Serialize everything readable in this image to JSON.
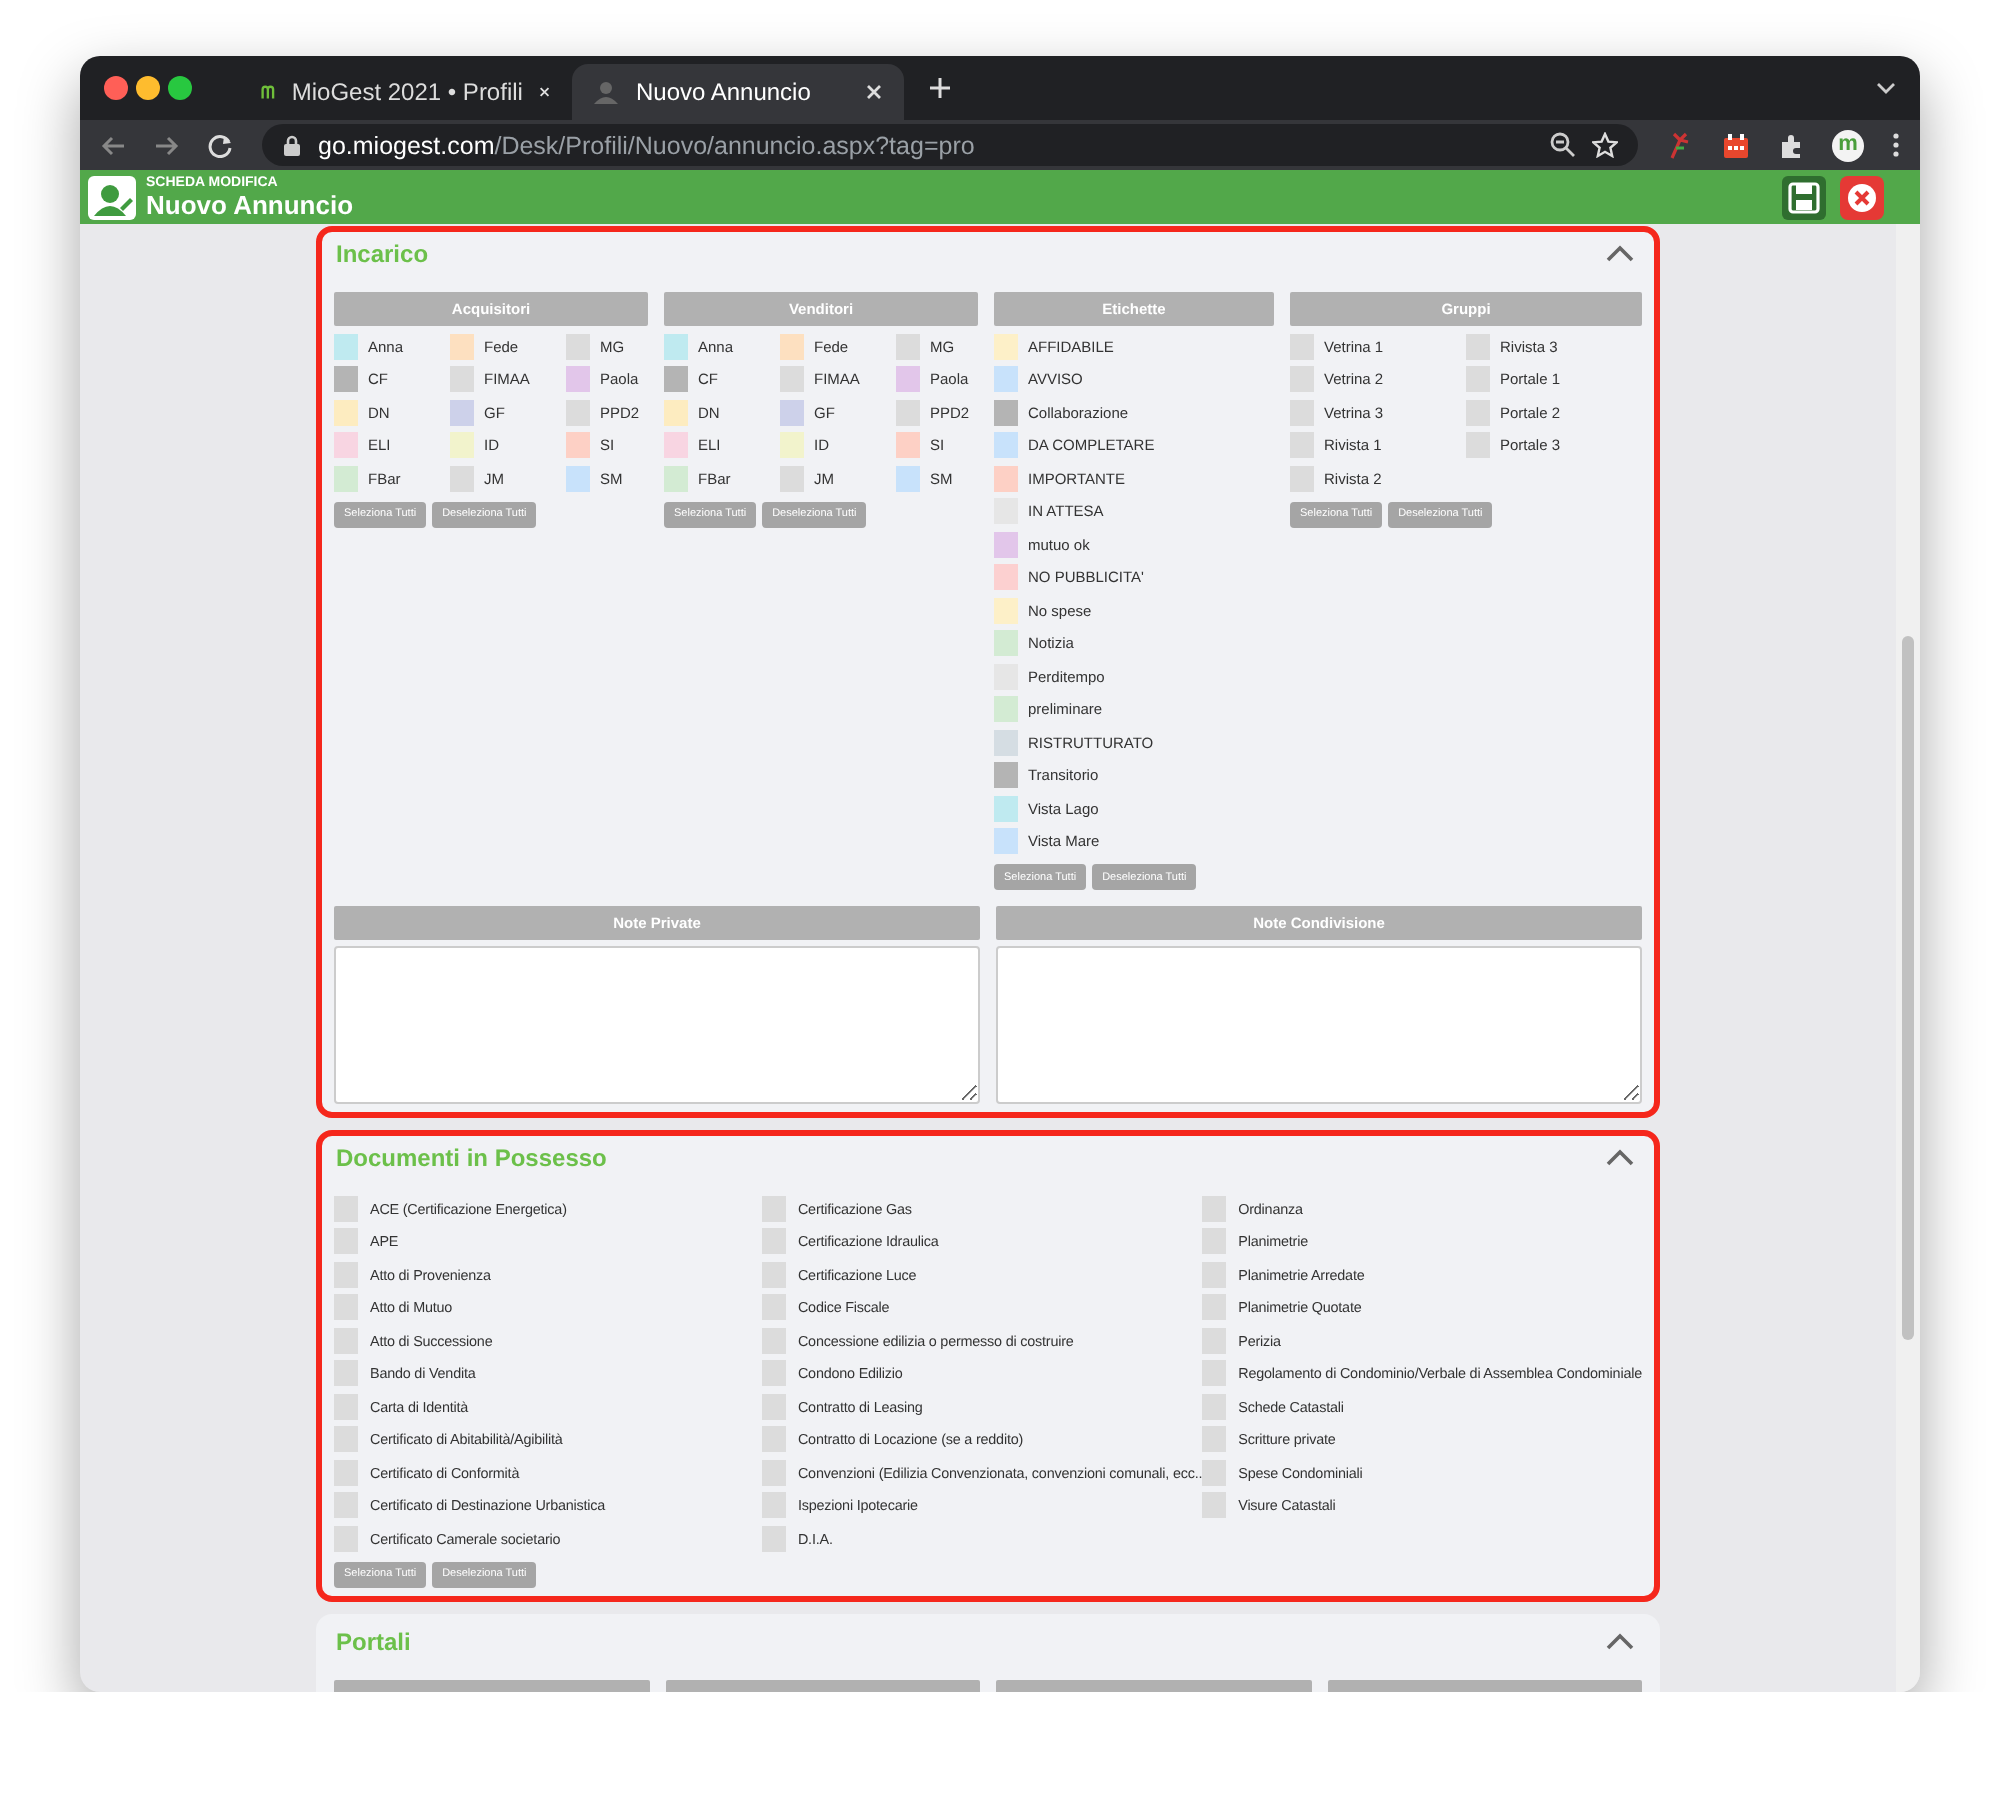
{
  "browser": {
    "tabs": [
      {
        "title": "MioGest 2021 • Profili",
        "selected": false
      },
      {
        "title": "Nuovo Annuncio",
        "selected": true
      }
    ],
    "url_host": "go.miogest.com",
    "url_path": "/Desk/Profili/Nuovo/annuncio.aspx?tag=pro",
    "profile_initial": "m"
  },
  "header": {
    "subtitle": "SCHEDA MODIFICA",
    "title": "Nuovo Annuncio"
  },
  "sections": [
    {
      "title": "Incarico",
      "kind": "groups",
      "highlighted": true,
      "expanded": true,
      "groups": [
        {
          "title": "Acquisitori",
          "columns": [
            [
              {
                "label": "Anna",
                "color": "#bfeaf0"
              },
              {
                "label": "CF",
                "color": "#b4b4b4"
              },
              {
                "label": "DN",
                "color": "#fdecc0"
              },
              {
                "label": "ELI",
                "color": "#f8d5e2"
              },
              {
                "label": "FBar",
                "color": "#d3ebd3"
              }
            ],
            [
              {
                "label": "Fede",
                "color": "#fde0c0"
              },
              {
                "label": "FIMAA",
                "color": "#dcdcdc"
              },
              {
                "label": "GF",
                "color": "#cdd1ea"
              },
              {
                "label": "ID",
                "color": "#f2f3cc"
              },
              {
                "label": "JM",
                "color": "#dcdcdc"
              }
            ],
            [
              {
                "label": "MG",
                "color": "#dcdcdc"
              },
              {
                "label": "Paola",
                "color": "#e2c6ea"
              },
              {
                "label": "PPD2",
                "color": "#dcdcdc"
              },
              {
                "label": "SI",
                "color": "#fdd0c5"
              },
              {
                "label": "SM",
                "color": "#c8e2fb"
              }
            ]
          ],
          "buttons": [
            "Seleziona Tutti",
            "Deseleziona Tutti"
          ]
        },
        {
          "title": "Venditori",
          "columns": [
            [
              {
                "label": "Anna",
                "color": "#bfeaf0"
              },
              {
                "label": "CF",
                "color": "#b4b4b4"
              },
              {
                "label": "DN",
                "color": "#fdecc0"
              },
              {
                "label": "ELI",
                "color": "#f8d5e2"
              },
              {
                "label": "FBar",
                "color": "#d3ebd3"
              }
            ],
            [
              {
                "label": "Fede",
                "color": "#fde0c0"
              },
              {
                "label": "FIMAA",
                "color": "#dcdcdc"
              },
              {
                "label": "GF",
                "color": "#cdd1ea"
              },
              {
                "label": "ID",
                "color": "#f2f3cc"
              },
              {
                "label": "JM",
                "color": "#dcdcdc"
              }
            ],
            [
              {
                "label": "MG",
                "color": "#dcdcdc"
              },
              {
                "label": "Paola",
                "color": "#e2c6ea"
              },
              {
                "label": "PPD2",
                "color": "#dcdcdc"
              },
              {
                "label": "SI",
                "color": "#fdd0c5"
              },
              {
                "label": "SM",
                "color": "#c8e2fb"
              }
            ]
          ],
          "buttons": [
            "Seleziona Tutti",
            "Deseleziona Tutti"
          ]
        },
        {
          "title": "Etichette",
          "columns": [
            [
              {
                "label": "AFFIDABILE",
                "color": "#fdf0c8"
              },
              {
                "label": "AVVISO",
                "color": "#c8e2fb"
              },
              {
                "label": "Collaborazione",
                "color": "#b4b4b4"
              },
              {
                "label": "DA COMPLETARE",
                "color": "#c8e2fb"
              },
              {
                "label": "IMPORTANTE",
                "color": "#fdd0c5"
              },
              {
                "label": "IN ATTESA",
                "color": "#e6e6e6"
              },
              {
                "label": "mutuo ok",
                "color": "#e2c6ea"
              },
              {
                "label": "NO PUBBLICITA'",
                "color": "#fcd0d0"
              },
              {
                "label": "No spese",
                "color": "#fdf0c8"
              },
              {
                "label": "Notizia",
                "color": "#d3ebd3"
              },
              {
                "label": "Perditempo",
                "color": "#e6e6e6"
              },
              {
                "label": "preliminare",
                "color": "#d3ebd3"
              },
              {
                "label": "RISTRUTTURATO",
                "color": "#d5dde3"
              },
              {
                "label": "Transitorio",
                "color": "#b4b4b4"
              },
              {
                "label": "Vista Lago",
                "color": "#bfeaf0"
              },
              {
                "label": "Vista Mare",
                "color": "#c8e2fb"
              }
            ]
          ],
          "buttons": [
            "Seleziona Tutti",
            "Deseleziona Tutti"
          ]
        },
        {
          "title": "Gruppi",
          "columns": [
            [
              {
                "label": "Vetrina 1"
              },
              {
                "label": "Vetrina 2"
              },
              {
                "label": "Vetrina 3"
              },
              {
                "label": "Rivista 1"
              },
              {
                "label": "Rivista 2"
              }
            ],
            [
              {
                "label": "Rivista 3"
              },
              {
                "label": "Portale 1"
              },
              {
                "label": "Portale 2"
              },
              {
                "label": "Portale 3"
              }
            ]
          ],
          "buttons": [
            "Seleziona Tutti",
            "Deseleziona Tutti"
          ]
        }
      ],
      "notes": [
        {
          "title": "Note Private"
        },
        {
          "title": "Note Condivisione"
        }
      ]
    },
    {
      "title": "Documenti in Possesso",
      "kind": "checklist",
      "highlighted": true,
      "expanded": true,
      "columns": [
        [
          "ACE (Certificazione Energetica)",
          "APE",
          "Atto di Provenienza",
          "Atto di Mutuo",
          "Atto di Successione",
          "Bando di Vendita",
          "Carta di Identità",
          "Certificato di Abitabilità/Agibilità",
          "Certificato di Conformità",
          "Certificato di Destinazione Urbanistica",
          "Certificato Camerale societario"
        ],
        [
          "Certificazione Gas",
          "Certificazione Idraulica",
          "Certificazione Luce",
          "Codice Fiscale",
          "Concessione edilizia o permesso di costruire",
          "Condono Edilizio",
          "Contratto di Leasing",
          "Contratto di Locazione (se a reddito)",
          "Convenzioni (Edilizia Convenzionata, convenzioni comunali, ecc..",
          "Ispezioni Ipotecarie",
          "D.I.A."
        ],
        [
          "Ordinanza",
          "Planimetrie",
          "Planimetrie Arredate",
          "Planimetrie Quotate",
          "Perizia",
          "Regolamento di Condominio/Verbale di Assemblea Condominiale",
          "Schede Catastali",
          "Scritture private",
          "Spese Condominiali",
          "Visure Catastali"
        ]
      ],
      "buttons": [
        "Seleziona Tutti",
        "Deseleziona Tutti"
      ]
    },
    {
      "title": "Portali",
      "kind": "cut",
      "highlighted": false,
      "expanded": true
    }
  ]
}
